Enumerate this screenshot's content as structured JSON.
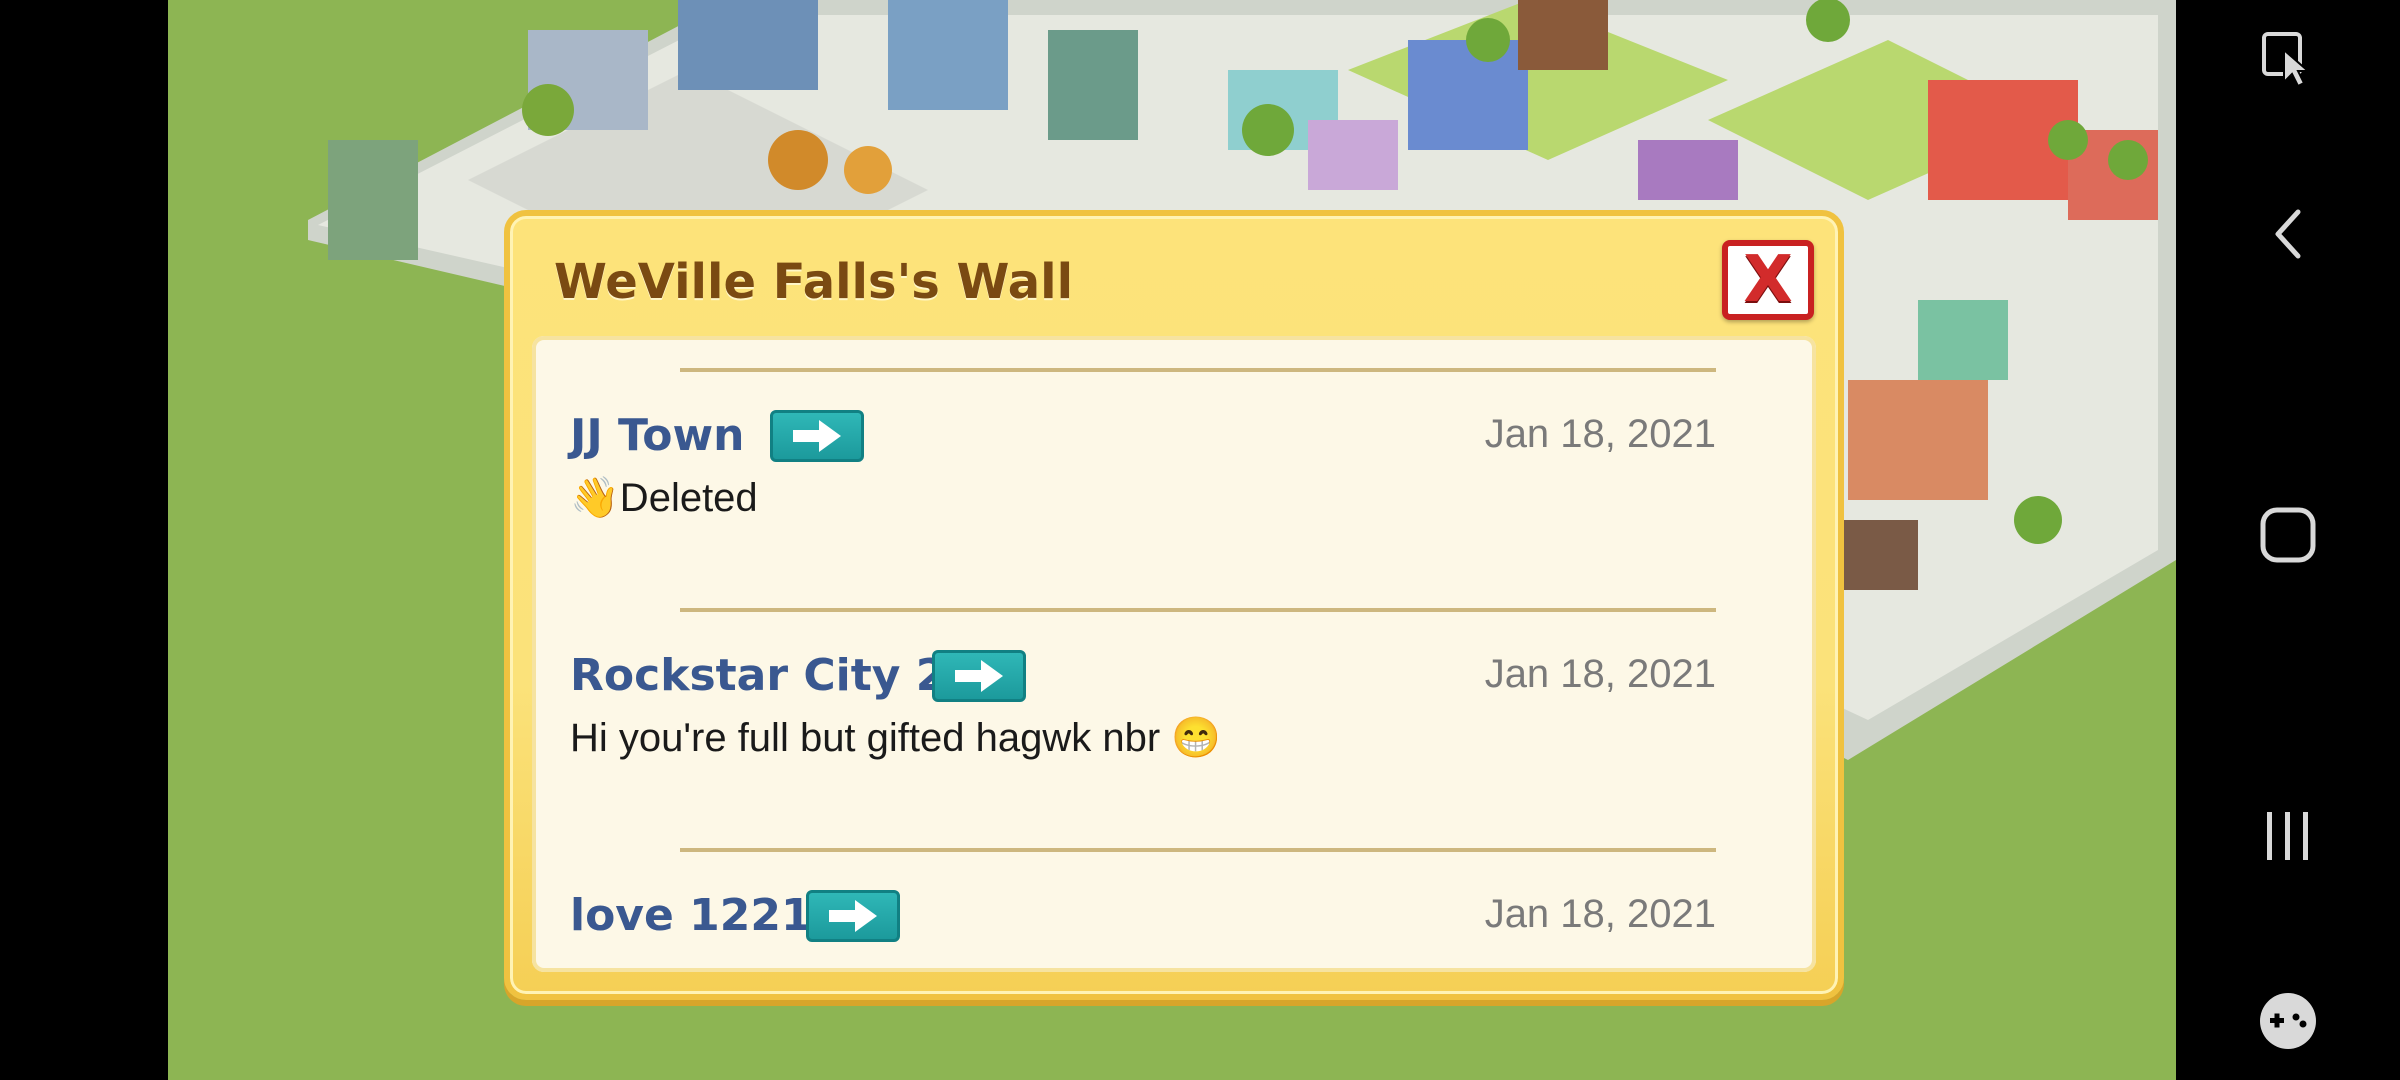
{
  "wall": {
    "title": "WeVille Falls's Wall",
    "close_label": "X",
    "posts": [
      {
        "author": "JJ Town",
        "date": "Jan 18, 2021",
        "message": "👋Deleted"
      },
      {
        "author": "Rockstar City 2",
        "date": "Jan 18, 2021",
        "message": "Hi you're full but gifted hagwk nbr 😁"
      },
      {
        "author": "love 1221",
        "date": "Jan 18, 2021",
        "message": ""
      }
    ]
  },
  "icons": {
    "go": "arrow-right-icon",
    "close": "close-icon",
    "nav": [
      "pointer-icon",
      "back-icon",
      "home-icon",
      "recents-icon",
      "game-controller-icon"
    ]
  },
  "colors": {
    "modal_bg": "#fde37a",
    "panel_bg": "#fdf8e7",
    "author": "#3a5890",
    "title": "#7a4a12",
    "close": "#d22b2b",
    "go_button": "#2fb7b7",
    "grass": "#8db553"
  }
}
